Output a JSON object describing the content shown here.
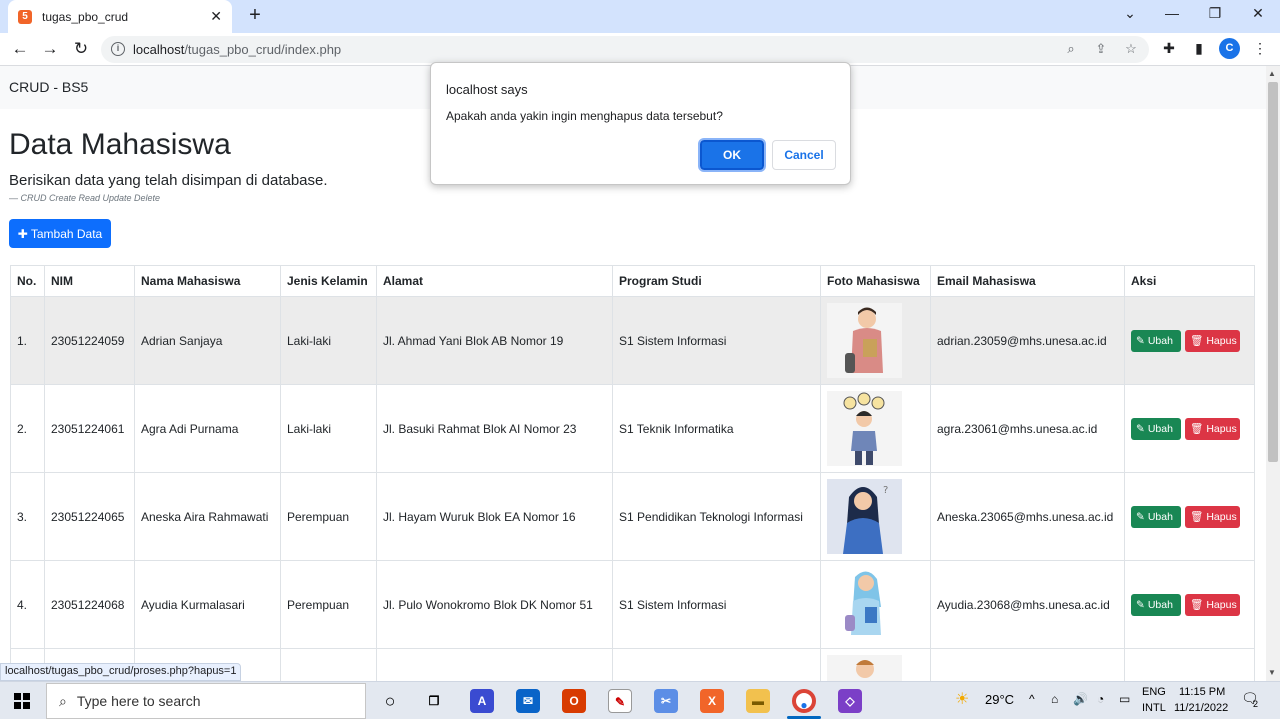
{
  "browser": {
    "tab_title": "tugas_pbo_crud",
    "url_host": "localhost",
    "url_path": "/tugas_pbo_crud/index.php",
    "profile_initial": "C",
    "status_url": "localhost/tugas_pbo_crud/proses.php?hapus=1"
  },
  "page": {
    "brand": "CRUD - BS5",
    "title": "Data Mahasiswa",
    "lead": "Berisikan data yang telah disimpan di database.",
    "footnote": "— CRUD Create Read Update Delete",
    "add_button": "Tambah Data"
  },
  "table": {
    "headers": [
      "No.",
      "NIM",
      "Nama Mahasiswa",
      "Jenis Kelamin",
      "Alamat",
      "Program Studi",
      "Foto Mahasiswa",
      "Email Mahasiswa",
      "Aksi"
    ],
    "rows": [
      {
        "no": "1.",
        "nim": "23051224059",
        "nama": "Adrian Sanjaya",
        "jk": "Laki-laki",
        "alamat": "Jl. Ahmad Yani Blok AB Nomor 19",
        "prodi": "S1 Sistem Informasi",
        "email": "adrian.23059@mhs.unesa.ac.id"
      },
      {
        "no": "2.",
        "nim": "23051224061",
        "nama": "Agra Adi Purnama",
        "jk": "Laki-laki",
        "alamat": "Jl. Basuki Rahmat Blok AI Nomor 23",
        "prodi": "S1 Teknik Informatika",
        "email": "agra.23061@mhs.unesa.ac.id"
      },
      {
        "no": "3.",
        "nim": "23051224065",
        "nama": "Aneska Aira Rahmawati",
        "jk": "Perempuan",
        "alamat": "Jl. Hayam Wuruk Blok EA Nomor 16",
        "prodi": "S1 Pendidikan Teknologi Informasi",
        "email": "Aneska.23065@mhs.unesa.ac.id"
      },
      {
        "no": "4.",
        "nim": "23051224068",
        "nama": "Ayudia Kurmalasari",
        "jk": "Perempuan",
        "alamat": "Jl. Pulo Wonokromo Blok DK Nomor 51",
        "prodi": "S1 Sistem Informasi",
        "email": "Ayudia.23068@mhs.unesa.ac.id"
      }
    ],
    "ubah_label": "Ubah",
    "hapus_label": "Hapus"
  },
  "dialog": {
    "title": "localhost says",
    "message": "Apakah anda yakin ingin menghapus data tersebut?",
    "ok": "OK",
    "cancel": "Cancel"
  },
  "taskbar": {
    "search_placeholder": "Type here to search",
    "temperature": "29°C",
    "lang_top": "ENG",
    "lang_bottom": "INTL",
    "time": "11:15 PM",
    "date": "11/21/2022",
    "notification_count": "2"
  }
}
